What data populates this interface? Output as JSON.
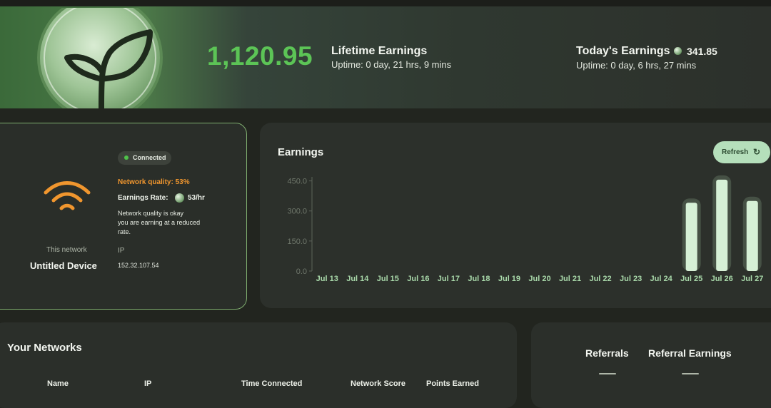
{
  "header": {
    "balance": "1,120.95",
    "lifetime": {
      "title": "Lifetime Earnings",
      "uptime": "Uptime: 0 day, 21 hrs, 9 mins"
    },
    "today": {
      "title": "Today's Earnings",
      "value": "341.85",
      "uptime": "Uptime: 0 day, 6 hrs, 27 mins"
    }
  },
  "device": {
    "status": "Connected",
    "network_quality": "Network quality: 53%",
    "earnings_rate_label": "Earnings Rate:",
    "earnings_rate_value": "53/hr",
    "note_lines": [
      "Network quality is okay",
      "you are earning at a reduced",
      "rate."
    ],
    "network_label": "This network",
    "device_name": "Untitled Device",
    "ip_label": "IP",
    "ip_value": "152.32.107.54"
  },
  "earnings_card": {
    "title": "Earnings",
    "refresh_label": "Refresh",
    "refresh_icon": "refresh-icon"
  },
  "chart_data": {
    "type": "bar",
    "categories": [
      "Jul 13",
      "Jul 14",
      "Jul 15",
      "Jul 16",
      "Jul 17",
      "Jul 18",
      "Jul 19",
      "Jul 20",
      "Jul 21",
      "Jul 22",
      "Jul 23",
      "Jul 24",
      "Jul 25",
      "Jul 26",
      "Jul 27"
    ],
    "values": [
      0,
      0,
      0,
      0,
      0,
      0,
      0,
      0,
      0,
      0,
      0,
      0,
      341,
      456,
      350
    ],
    "ylim": [
      0,
      470
    ],
    "yticks": [
      0,
      150,
      300,
      450
    ],
    "ytick_labels": [
      "0.0",
      "150.0",
      "300.0",
      "450.0"
    ],
    "grid": false,
    "title": "Earnings",
    "xlabel": "",
    "ylabel": ""
  },
  "networks": {
    "title": "Your Networks",
    "columns": [
      "Name",
      "IP",
      "Time Connected",
      "Network Score",
      "Points Earned"
    ]
  },
  "referrals": {
    "col1": "Referrals",
    "col2": "Referral Earnings"
  },
  "colors": {
    "accent_green": "#5cc456",
    "quality_orange": "#f0962e",
    "bar": "#d6f0d6"
  }
}
